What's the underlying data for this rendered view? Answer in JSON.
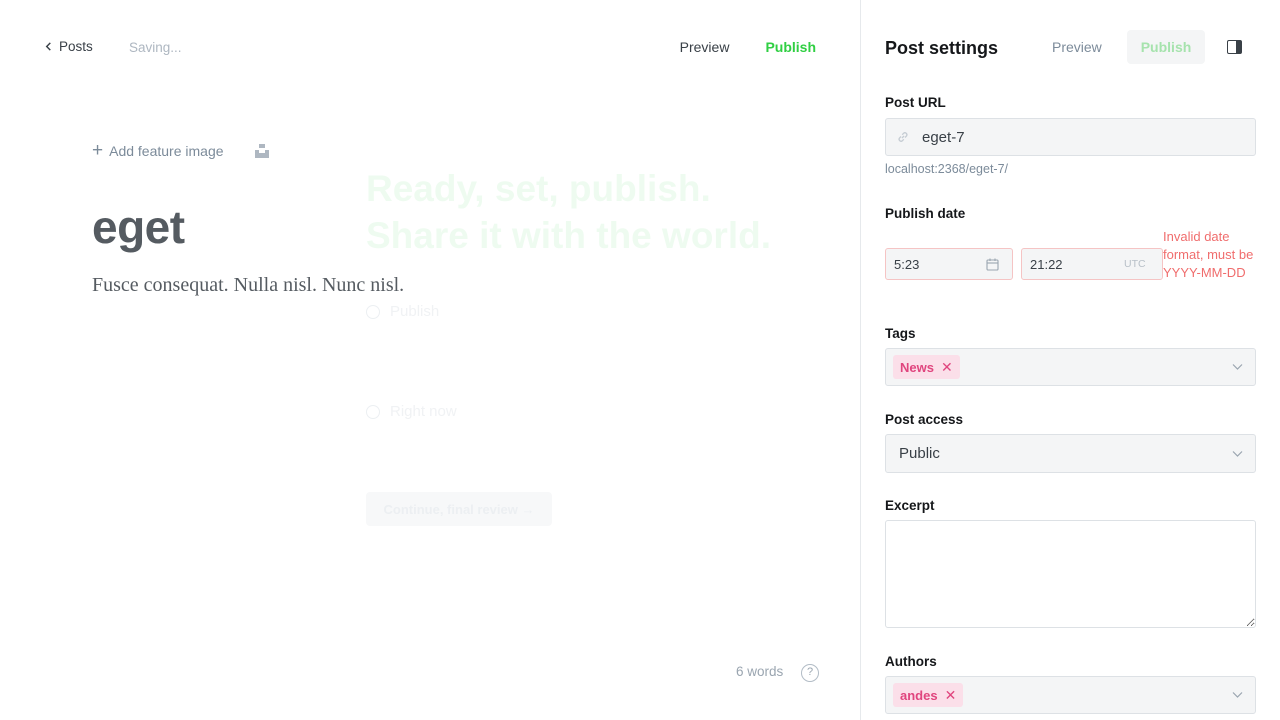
{
  "editor": {
    "back_label": "Posts",
    "status": "Saving...",
    "preview_label": "Preview",
    "publish_label": "Publish",
    "feature_image_label": "Add feature image",
    "title": "eget",
    "body": "Fusce consequat. Nulla nisl. Nunc nisl.",
    "word_count": "6 words",
    "help_label": "?"
  },
  "publish_overlay": {
    "heading_line1": "Ready, set, publish.",
    "heading_line2": "Share it with the world.",
    "option_publish": "Publish",
    "option_when": "Right now",
    "continue_label": "Continue, final review →"
  },
  "settings": {
    "title": "Post settings",
    "preview_label": "Preview",
    "publish_label": "Publish",
    "url_label": "Post URL",
    "url_value": "eget-7",
    "url_hint": "localhost:2368/eget-7/",
    "publish_date_label": "Publish date",
    "date_value": "5:23",
    "time_value": "21:22",
    "timezone": "UTC",
    "date_error": "Invalid date format, must be YYYY-MM-DD",
    "tags_label": "Tags",
    "tags": [
      "News"
    ],
    "access_label": "Post access",
    "access_value": "Public",
    "excerpt_label": "Excerpt",
    "excerpt_value": "",
    "authors_label": "Authors",
    "authors": [
      "andes"
    ]
  },
  "colors": {
    "accent_green": "#30cf43",
    "error_red": "#f06d6d",
    "token_pink": "#e0457e"
  }
}
